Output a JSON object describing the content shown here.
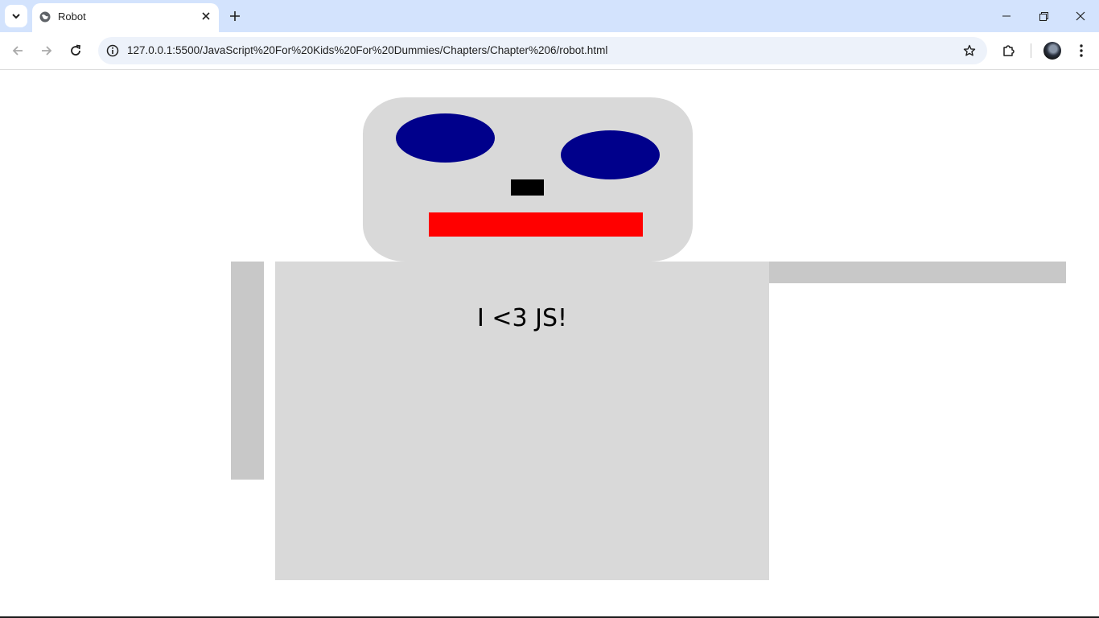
{
  "browser": {
    "tab": {
      "title": "Robot",
      "favicon": "globe-icon"
    },
    "address_bar": {
      "url": "127.0.0.1:5500/JavaScript%20For%20Kids%20For%20Dummies/Chapters/Chapter%206/robot.html"
    },
    "icons": {
      "tab_search": "chevron-down-icon",
      "tab_close": "close-icon",
      "new_tab": "plus-icon",
      "back": "arrow-left-icon",
      "forward": "arrow-right-icon",
      "reload": "reload-icon",
      "site_info": "info-icon",
      "bookmark": "star-icon",
      "extensions": "puzzle-icon",
      "menu": "kebab-menu-icon",
      "minimize": "minimize-icon",
      "restore": "restore-icon",
      "close_window": "close-icon"
    }
  },
  "page": {
    "torso_text": "I <3 JS!",
    "colors": {
      "head": "#d9d9d9",
      "eyes": "#00008b",
      "nose": "#000000",
      "mouth": "#ff0000",
      "torso": "#d9d9d9",
      "arms": "#c8c8c8"
    }
  }
}
